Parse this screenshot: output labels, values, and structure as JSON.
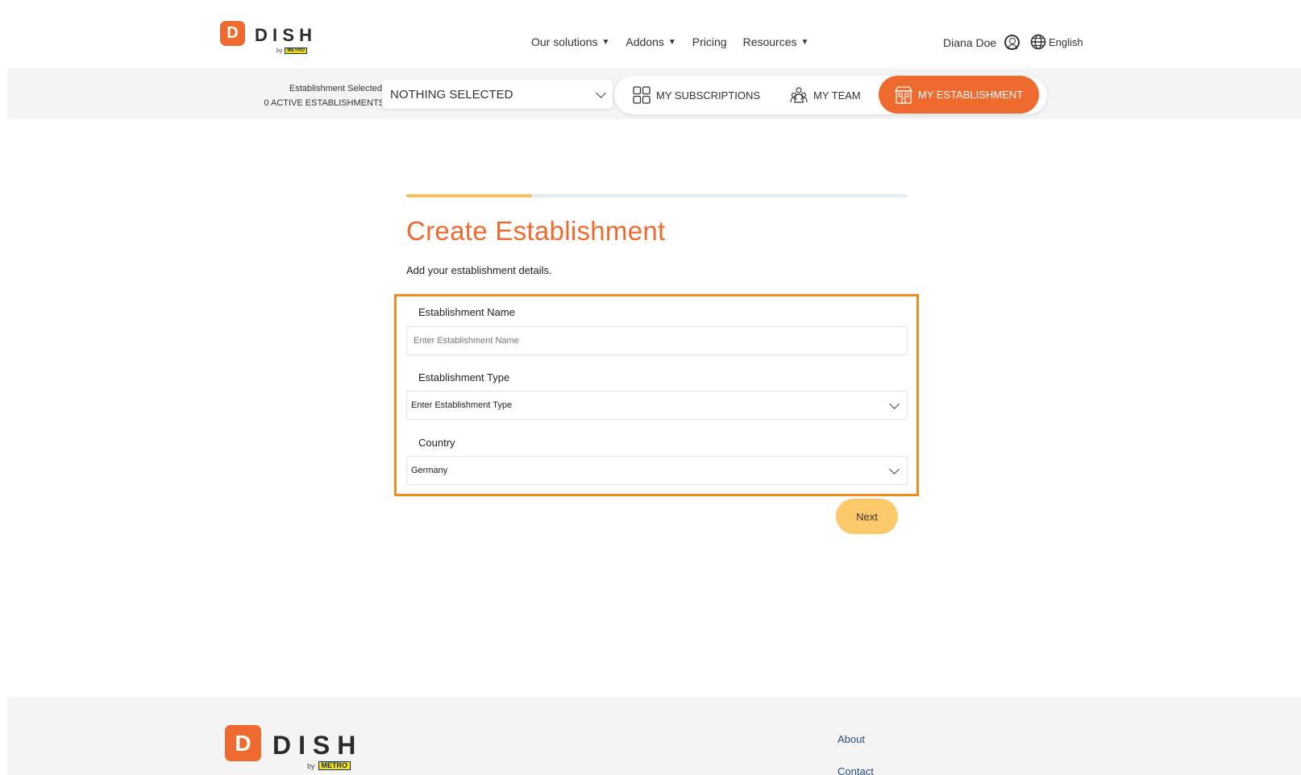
{
  "brand": {
    "name": "DISH",
    "mark": "D",
    "by": "by",
    "metro": "METRO",
    "accent": "#ef6a2e"
  },
  "nav": {
    "items": [
      {
        "label": "Our solutions",
        "caret": "▼"
      },
      {
        "label": "Addons",
        "caret": "▼"
      },
      {
        "label": "Pricing",
        "caret": ""
      },
      {
        "label": "Resources",
        "caret": "▼"
      }
    ],
    "user_name": "Diana Doe",
    "language": "English"
  },
  "establishment_bar": {
    "label_line1": "Establishment Selected:",
    "label_line2": "0 ACTIVE ESTABLISHMENTS",
    "selected": "NOTHING SELECTED",
    "tabs": {
      "subscriptions": "MY SUBSCRIPTIONS",
      "team": "MY TEAM",
      "establishment": "MY ESTABLISHMENT"
    }
  },
  "progress": {
    "value": 0.25,
    "fill_color": "#f7bf55"
  },
  "page": {
    "title": "Create Establishment",
    "subtitle": "Add your establishment details."
  },
  "form": {
    "name_label": "Establishment Name",
    "name_placeholder": "Enter Establishment Name",
    "type_label": "Establishment Type",
    "type_value": "Enter Establishment Type",
    "country_label": "Country",
    "country_value": "Germany",
    "highlight_color": "#f28a1e"
  },
  "actions": {
    "next": "Next"
  },
  "footer": {
    "links": [
      "About",
      "Contact"
    ]
  }
}
